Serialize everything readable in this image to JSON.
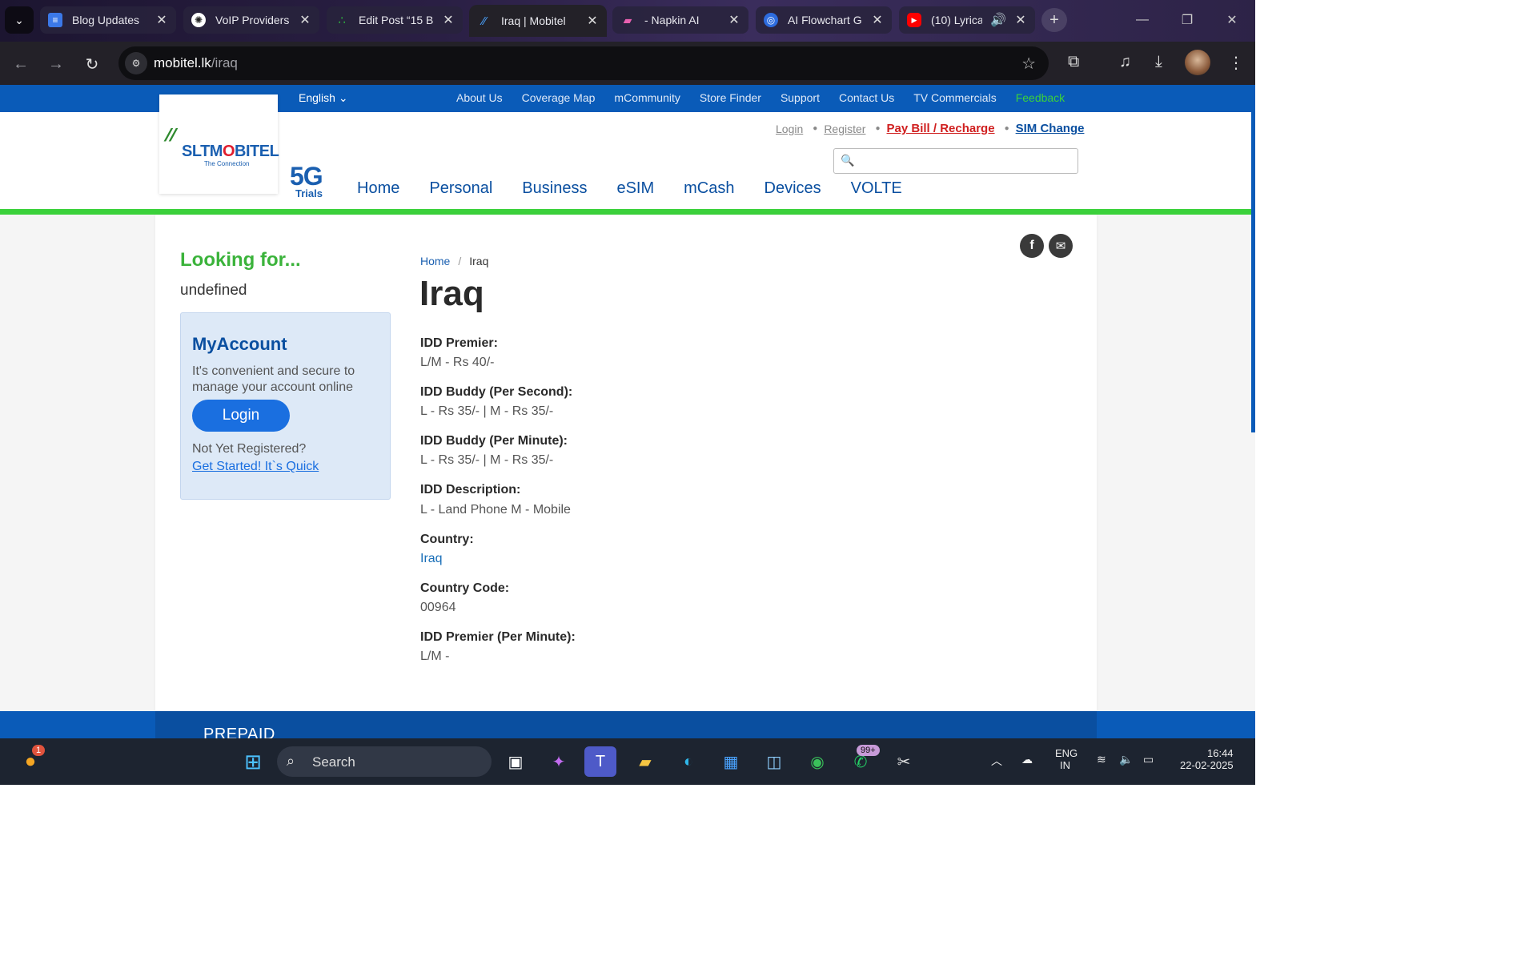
{
  "browser": {
    "tabs": [
      {
        "title": "Blog Updates",
        "icon": "docs-icon"
      },
      {
        "title": "VoIP Providers",
        "icon": "openai-icon"
      },
      {
        "title": "Edit Post “15 B",
        "icon": "dots-icon"
      },
      {
        "title": "Iraq | Mobitel",
        "icon": "mobitel-icon",
        "active": true
      },
      {
        "title": "- Napkin AI",
        "icon": "napkin-icon"
      },
      {
        "title": "AI Flowchart G",
        "icon": "flowchart-icon"
      },
      {
        "title": "(10) Lyrica",
        "icon": "youtube-icon"
      }
    ],
    "url_domain": "mobitel.lk",
    "url_path": "/iraq"
  },
  "site": {
    "language": "English",
    "top_links": [
      "About Us",
      "Coverage Map",
      "mCommunity",
      "Store Finder",
      "Support",
      "Contact Us",
      "TV Commercials",
      "Feedback"
    ],
    "logo_text_a": "SLTM",
    "logo_text_o": "O",
    "logo_text_b": "BITEL",
    "logo_tagline": "The Connection",
    "badge_5g": "5G",
    "badge_trials": "Trials",
    "account_links": {
      "login": "Login",
      "register": "Register",
      "pay": "Pay Bill / Recharge",
      "sim": "SIM Change"
    },
    "search_placeholder": "",
    "main_nav": [
      "Home",
      "Personal",
      "Business",
      "eSIM",
      "mCash",
      "Devices",
      "VOLTE"
    ],
    "brand_colors": {
      "blue": "#0a5bb8",
      "green": "#3bd13b",
      "red": "#d02020"
    }
  },
  "sidebar": {
    "looking_for": "Looking for...",
    "looking_value": "undefined",
    "account": {
      "title": "MyAccount",
      "desc": "It's convenient and secure to manage your account online",
      "login": "Login",
      "question": "Not Yet Registered?",
      "link": "Get Started! It`s Quick"
    }
  },
  "page": {
    "breadcrumb": {
      "home": "Home",
      "separator": "/",
      "current": "Iraq"
    },
    "title": "Iraq",
    "fields": [
      {
        "label": "IDD Premier:",
        "value": "L/M - Rs 40/-"
      },
      {
        "label": "IDD Buddy (Per Second):",
        "value": "L - Rs 35/- | M - Rs 35/-"
      },
      {
        "label": "IDD Buddy (Per Minute):",
        "value": "L - Rs 35/- | M - Rs 35/-"
      },
      {
        "label": "IDD Description:",
        "value": "L - Land Phone M - Mobile"
      },
      {
        "label": "Country:",
        "value": "Iraq",
        "link": true
      },
      {
        "label": "Country Code:",
        "value": "00964"
      },
      {
        "label": "IDD Premier (Per Minute):",
        "value": "L/M -"
      }
    ],
    "share": {
      "facebook": "f",
      "email": "✉"
    }
  },
  "footer": {
    "section_title": "PREPAID"
  },
  "taskbar": {
    "notification_count": "1",
    "search_label": "Search",
    "whatsapp_badge": "99+",
    "lang_top": "ENG",
    "lang_bottom": "IN",
    "time": "16:44",
    "date": "22-02-2025"
  }
}
